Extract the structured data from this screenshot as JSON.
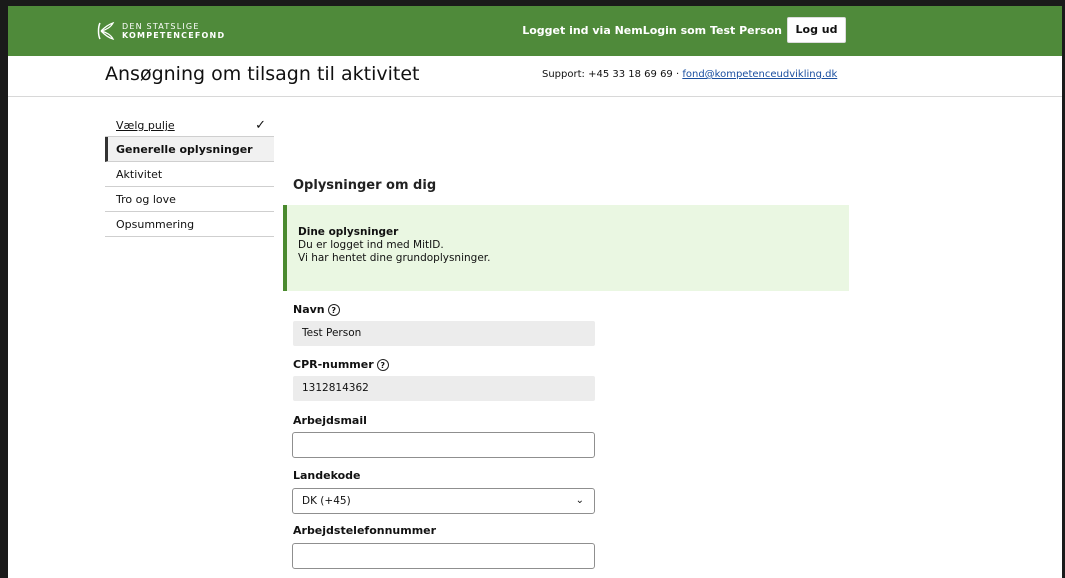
{
  "topbar": {
    "logo_line1": "DEN STATSLIGE",
    "logo_line2": "KOMPETENCEFOND",
    "login_status": "Logget ind via NemLogin som Test Person",
    "logout_label": "Log ud",
    "color": "#4f8a3a"
  },
  "header": {
    "title": "Ansøgning om tilsagn til aktivitet",
    "support_prefix": "Support: +45 33 18 69 69 · ",
    "support_email": "fond@kompetenceudvikling.dk"
  },
  "sidebar": {
    "items": [
      {
        "label": "Vælg pulje",
        "state": "done",
        "icon": "check-icon"
      },
      {
        "label": "Generelle oplysninger",
        "state": "current"
      },
      {
        "label": "Aktivitet",
        "state": "pending"
      },
      {
        "label": "Tro og love",
        "state": "pending"
      },
      {
        "label": "Opsummering",
        "state": "pending"
      }
    ]
  },
  "main": {
    "section_title": "Oplysninger om dig",
    "info": {
      "title": "Dine oplysninger",
      "line1": "Du er logget ind med MitID.",
      "line2": "Vi har hentet dine grundoplysninger.",
      "color": "#eaf7e2"
    },
    "fields": {
      "name_label": "Navn",
      "name_value": "Test Person",
      "cpr_label": "CPR-nummer",
      "cpr_value": "1312814362",
      "work_email_label": "Arbejdsmail",
      "work_email_value": "",
      "country_code_label": "Landekode",
      "country_code_value": "DK (+45)",
      "work_phone_label": "Arbejdstelefonnummer",
      "work_phone_value": ""
    }
  }
}
